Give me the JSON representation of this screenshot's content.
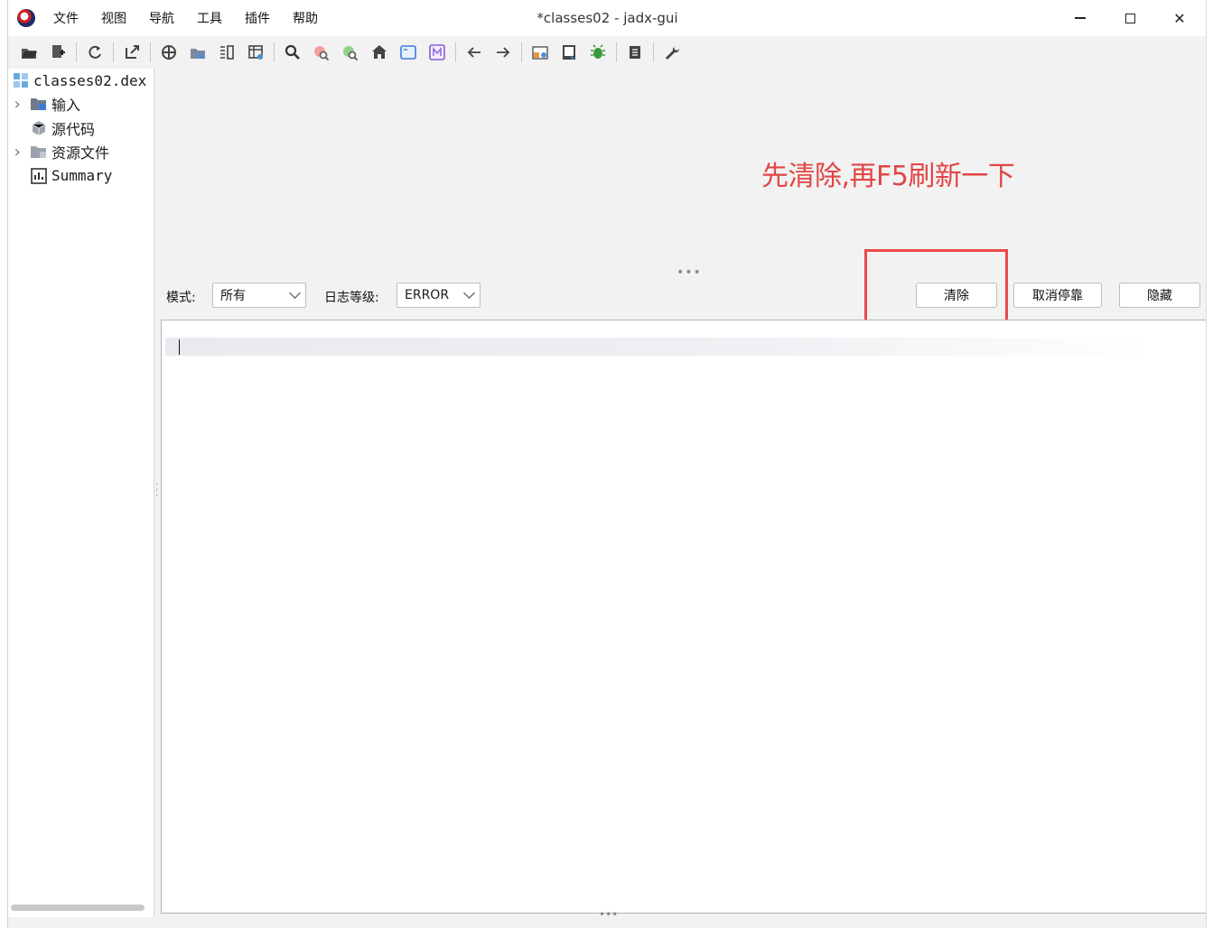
{
  "window": {
    "title": "*classes02 - jadx-gui",
    "controls": {
      "minimize": "minimize",
      "maximize": "maximize",
      "close": "✕"
    }
  },
  "menubar": {
    "items": [
      {
        "id": "file",
        "label": "文件"
      },
      {
        "id": "view",
        "label": "视图"
      },
      {
        "id": "nav",
        "label": "导航"
      },
      {
        "id": "tools",
        "label": "工具"
      },
      {
        "id": "plugins",
        "label": "插件"
      },
      {
        "id": "help",
        "label": "帮助"
      }
    ]
  },
  "toolbar": {
    "buttons": [
      "open-file-icon",
      "save-all-icon",
      "sep",
      "reload-icon",
      "sep",
      "export-icon",
      "sep",
      "sync-tree-icon",
      "flatten-packages-icon",
      "split-view-icon",
      "show-summary-icon",
      "sep",
      "search-icon",
      "search-usage-icon",
      "search-class-icon",
      "home-icon",
      "window-icon",
      "mode-icon",
      "sep",
      "back-arrow-icon",
      "forward-arrow-icon",
      "sep",
      "log-viewer-icon",
      "quark-icon",
      "debug-bug-icon",
      "sep",
      "script-icon",
      "sep",
      "preferences-wrench-icon"
    ]
  },
  "tree": {
    "root": {
      "label": "classes02.dex"
    },
    "items": [
      {
        "label": "输入",
        "expandable": true,
        "icon": "folder-input-icon"
      },
      {
        "label": "源代码",
        "expandable": false,
        "icon": "package-icon"
      },
      {
        "label": "资源文件",
        "expandable": true,
        "icon": "folder-resources-icon"
      },
      {
        "label": "Summary",
        "expandable": false,
        "icon": "summary-icon"
      }
    ]
  },
  "annotation": {
    "text": "先清除,再F5刷新一下",
    "color": "#e34545"
  },
  "log_panel": {
    "mode_label": "模式:",
    "mode_value": "所有",
    "level_label": "日志等级:",
    "level_value": "ERROR",
    "clear_label": "清除",
    "undock_label": "取消停靠",
    "hide_label": "隐藏",
    "content": ""
  },
  "colors": {
    "accent_red": "#ea4a4a",
    "background": "#f2f2f2"
  }
}
